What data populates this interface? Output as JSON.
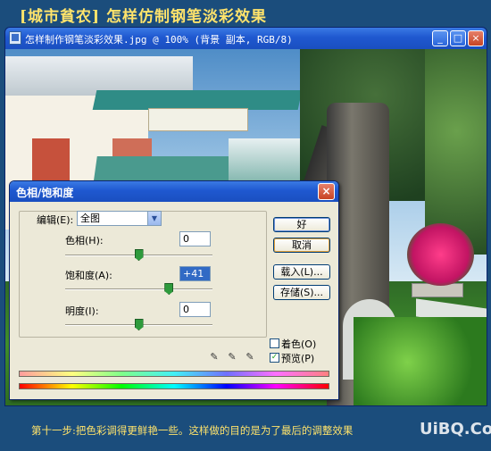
{
  "banner": {
    "text": "[城市貧农] 怎样仿制钢笔淡彩效果"
  },
  "image_window": {
    "title": "怎样制作钢笔淡彩效果.jpg @ 100% (背景 副本, RGB/8)",
    "minimize_label": "_",
    "maximize_label": "□",
    "close_label": "×"
  },
  "dialog": {
    "title": "色相/饱和度",
    "close_label": "×",
    "edit_label": "编辑(E):",
    "edit_value": "全图",
    "hue": {
      "label": "色相(H):",
      "value": "0",
      "level": 0.5
    },
    "saturation": {
      "label": "饱和度(A):",
      "value": "+41",
      "level": 0.705
    },
    "lightness": {
      "label": "明度(I):",
      "value": "0",
      "level": 0.5
    },
    "buttons": {
      "ok": "好",
      "cancel": "取消",
      "load": "载入(L)...",
      "save": "存储(S)..."
    },
    "colorize": {
      "label": "着色(O)",
      "checked": false
    },
    "preview": {
      "label": "预览(P)",
      "checked": true
    }
  },
  "caption": {
    "step": "第十一步:",
    "text": "把色彩调得更鲜艳一些。这样做的目的是为了最后的调整效果",
    "watermark": "UiBQ.CoM"
  },
  "colors": {
    "banner_text": "#ffe36b",
    "background": "#1b4d7c",
    "titlebar": "#1f58d0"
  }
}
